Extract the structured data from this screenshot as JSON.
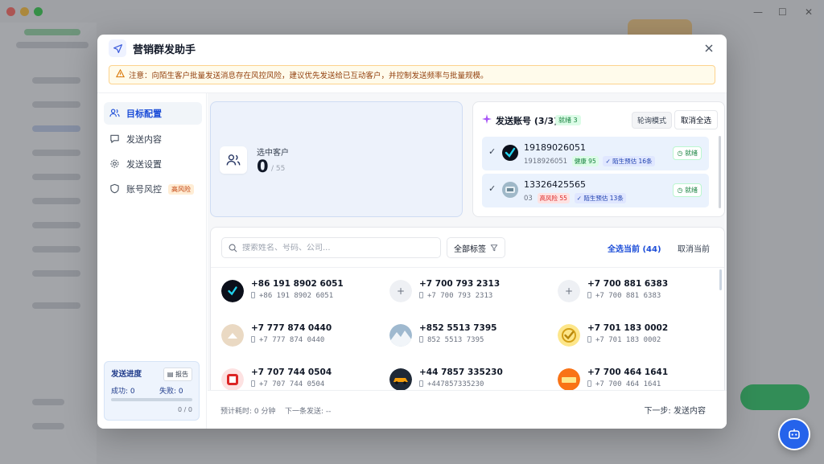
{
  "modal": {
    "title": "营销群发助手",
    "warning": "注意：向陌生客户批量发送消息存在风控风险，建议优先发送给已互动客户，并控制发送频率与批量规模。"
  },
  "nav": {
    "items": [
      {
        "label": "目标配置",
        "icon": "users-icon",
        "active": true
      },
      {
        "label": "发送内容",
        "icon": "message-icon",
        "active": false
      },
      {
        "label": "发送设置",
        "icon": "gear-icon",
        "active": false
      },
      {
        "label": "账号风控",
        "icon": "shield-icon",
        "active": false
      }
    ],
    "risk_tag": "高风险"
  },
  "progress": {
    "title": "发送进度",
    "report_btn": "报告",
    "success": "成功: 0",
    "fail": "失败: 0",
    "ratio": "0 / 0",
    "fraction": 0
  },
  "selected": {
    "label": "选中客户",
    "count": "0",
    "total": "/ 55"
  },
  "accounts": {
    "title": "发送账号 (3/3)",
    "ready_badge": "就绪 3",
    "mode_label": "轮询模式",
    "cancel_all": "取消全选",
    "items": [
      {
        "name": "19189026051",
        "sub": "1918926051",
        "health": "健康 95",
        "health_type": "green",
        "forecast": "✓ 陌生预估 16条",
        "status": "就绪"
      },
      {
        "name": "13326425565",
        "sub": "03",
        "health": "高风险 55",
        "health_type": "red",
        "forecast": "✓ 陌生预估 13条",
        "status": "就绪"
      }
    ]
  },
  "list": {
    "search_placeholder": "搜索姓名、号码、公司...",
    "tag_filter": "全部标签",
    "select_all": "全选当前 (44)",
    "cancel_current": "取消当前",
    "customers": [
      {
        "name": "+86 191 8902 6051",
        "number": "+86 191 8902 6051",
        "avatar": "logo-dark"
      },
      {
        "name": "+7 700 793 2313",
        "number": "+7 700 793 2313",
        "avatar": "placeholder"
      },
      {
        "name": "+7 700 881 6383",
        "number": "+7 700 881 6383",
        "avatar": "placeholder"
      },
      {
        "name": "+7 777 874 0440",
        "number": "+7 777 874 0440",
        "avatar": "beige"
      },
      {
        "name": "+852 5513 7395",
        "number": "852 5513 7395",
        "avatar": "mountain"
      },
      {
        "name": "+7 701 183 0002",
        "number": "+7 701 183 0002",
        "avatar": "gold-check"
      },
      {
        "name": "+7 707 744 0504",
        "number": "+7 707 744 0504",
        "avatar": "red-square"
      },
      {
        "name": "+44 7857 335230",
        "number": "+447857335230",
        "avatar": "car"
      },
      {
        "name": "+7 700 464 1641",
        "number": "+7 700 464 1641",
        "avatar": "orange"
      }
    ]
  },
  "footer": {
    "eta": "预计耗时: 0 分钟",
    "next_send": "下一条发送: --",
    "next_step": "下一步: 发送内容"
  }
}
